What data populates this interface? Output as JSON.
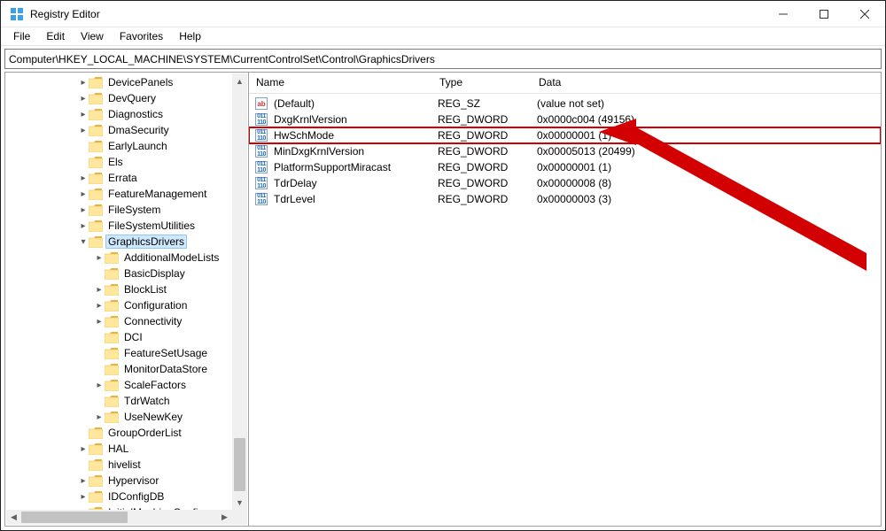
{
  "window": {
    "title": "Registry Editor"
  },
  "menus": {
    "file": "File",
    "edit": "Edit",
    "view": "View",
    "favorites": "Favorites",
    "help": "Help"
  },
  "address": "Computer\\HKEY_LOCAL_MACHINE\\SYSTEM\\CurrentControlSet\\Control\\GraphicsDrivers",
  "tree": {
    "items": [
      {
        "pad": 78,
        "tw": ">",
        "label": "DevicePanels"
      },
      {
        "pad": 78,
        "tw": ">",
        "label": "DevQuery"
      },
      {
        "pad": 78,
        "tw": ">",
        "label": "Diagnostics"
      },
      {
        "pad": 78,
        "tw": ">",
        "label": "DmaSecurity"
      },
      {
        "pad": 78,
        "tw": "",
        "label": "EarlyLaunch"
      },
      {
        "pad": 78,
        "tw": "",
        "label": "Els"
      },
      {
        "pad": 78,
        "tw": ">",
        "label": "Errata"
      },
      {
        "pad": 78,
        "tw": ">",
        "label": "FeatureManagement"
      },
      {
        "pad": 78,
        "tw": ">",
        "label": "FileSystem"
      },
      {
        "pad": 78,
        "tw": ">",
        "label": "FileSystemUtilities"
      },
      {
        "pad": 78,
        "tw": "v",
        "label": "GraphicsDrivers",
        "selected": true
      },
      {
        "pad": 96,
        "tw": ">",
        "label": "AdditionalModeLists"
      },
      {
        "pad": 96,
        "tw": "",
        "label": "BasicDisplay"
      },
      {
        "pad": 96,
        "tw": ">",
        "label": "BlockList"
      },
      {
        "pad": 96,
        "tw": ">",
        "label": "Configuration"
      },
      {
        "pad": 96,
        "tw": ">",
        "label": "Connectivity"
      },
      {
        "pad": 96,
        "tw": "",
        "label": "DCI"
      },
      {
        "pad": 96,
        "tw": "",
        "label": "FeatureSetUsage"
      },
      {
        "pad": 96,
        "tw": "",
        "label": "MonitorDataStore"
      },
      {
        "pad": 96,
        "tw": ">",
        "label": "ScaleFactors"
      },
      {
        "pad": 96,
        "tw": "",
        "label": "TdrWatch"
      },
      {
        "pad": 96,
        "tw": ">",
        "label": "UseNewKey"
      },
      {
        "pad": 78,
        "tw": "",
        "label": "GroupOrderList"
      },
      {
        "pad": 78,
        "tw": ">",
        "label": "HAL"
      },
      {
        "pad": 78,
        "tw": "",
        "label": "hivelist"
      },
      {
        "pad": 78,
        "tw": ">",
        "label": "Hypervisor"
      },
      {
        "pad": 78,
        "tw": ">",
        "label": "IDConfigDB"
      },
      {
        "pad": 78,
        "tw": "",
        "label": "InitialMachineConfig"
      }
    ]
  },
  "list": {
    "headers": {
      "name": "Name",
      "type": "Type",
      "data": "Data"
    },
    "rows": [
      {
        "icon": "sz",
        "name": "(Default)",
        "type": "REG_SZ",
        "data": "(value not set)"
      },
      {
        "icon": "dw",
        "name": "DxgKrnlVersion",
        "type": "REG_DWORD",
        "data": "0x0000c004 (49156)"
      },
      {
        "icon": "dw",
        "name": "HwSchMode",
        "type": "REG_DWORD",
        "data": "0x00000001 (1)",
        "highlighted": true
      },
      {
        "icon": "dw",
        "name": "MinDxgKrnlVersion",
        "type": "REG_DWORD",
        "data": "0x00005013 (20499)"
      },
      {
        "icon": "dw",
        "name": "PlatformSupportMiracast",
        "type": "REG_DWORD",
        "data": "0x00000001 (1)"
      },
      {
        "icon": "dw",
        "name": "TdrDelay",
        "type": "REG_DWORD",
        "data": "0x00000008 (8)"
      },
      {
        "icon": "dw",
        "name": "TdrLevel",
        "type": "REG_DWORD",
        "data": "0x00000003 (3)"
      }
    ]
  },
  "annotation": {
    "color": "#d20000"
  }
}
